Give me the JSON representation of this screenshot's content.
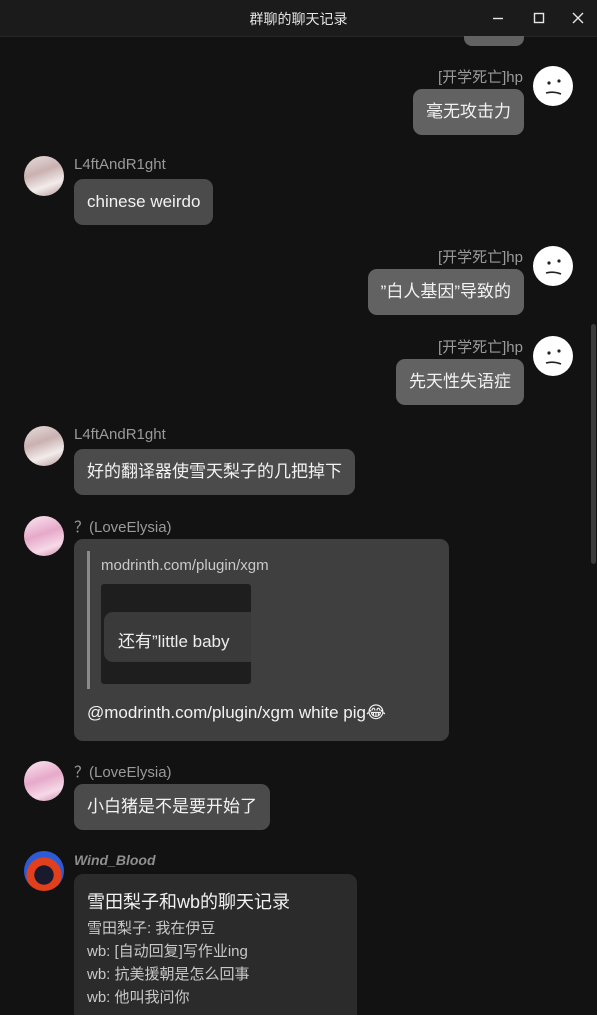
{
  "window": {
    "title": "群聊的聊天记录"
  },
  "messages": {
    "m1": {
      "sender": "[开学死亡]hp",
      "text": "毫无攻击力"
    },
    "m2": {
      "sender": "L4ftAndR1ght",
      "text": "chinese weirdo"
    },
    "m3": {
      "sender": "[开学死亡]hp",
      "text": "”白人基因”导致的"
    },
    "m4": {
      "sender": "[开学死亡]hp",
      "text": "先天性失语症"
    },
    "m5": {
      "sender": "L4ftAndR1ght",
      "text": "好的翻译器使雪天梨子的几把掉下"
    },
    "m6": {
      "sender": "？(LoveElysia)",
      "quote_author": "modrinth.com/plugin/xgm",
      "quote_text": "还有”little baby",
      "text": "@modrinth.com/plugin/xgm white pig",
      "emoji": "😂"
    },
    "m7": {
      "sender": "？(LoveElysia)",
      "text": "小白猪是不是要开始了"
    },
    "m8": {
      "sender": "Wind_Blood",
      "card_title": "雪田梨子和wb的聊天记录",
      "lines": [
        "雪田梨子: 我在伊豆",
        "wb: [自动回复]写作业ing",
        "wb: 抗美援朝是怎么回事",
        "wb: 他叫我问你"
      ]
    }
  },
  "icons": [
    "minimize-icon",
    "maximize-icon",
    "close-icon"
  ]
}
